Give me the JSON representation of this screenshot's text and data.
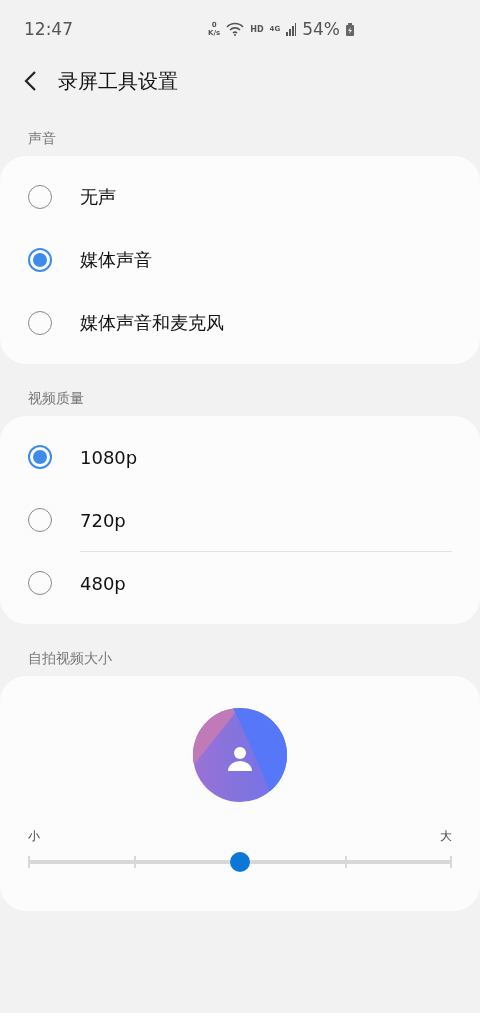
{
  "status_bar": {
    "time": "12:47",
    "net_speed_value": "0",
    "net_speed_unit": "K/s",
    "hd": "HD",
    "network": "4G",
    "battery": "54%"
  },
  "header": {
    "title": "录屏工具设置"
  },
  "groups": [
    {
      "title": "声音",
      "options": [
        {
          "label": "无声",
          "selected": false
        },
        {
          "label": "媒体声音",
          "selected": true
        },
        {
          "label": "媒体声音和麦克风",
          "selected": false
        }
      ]
    },
    {
      "title": "视频质量",
      "options": [
        {
          "label": "1080p",
          "selected": true
        },
        {
          "label": "720p",
          "selected": false
        },
        {
          "label": "480p",
          "selected": false
        }
      ]
    }
  ],
  "selfie_size": {
    "title": "自拍视频大小",
    "min_label": "小",
    "max_label": "大",
    "level": 0.5
  }
}
